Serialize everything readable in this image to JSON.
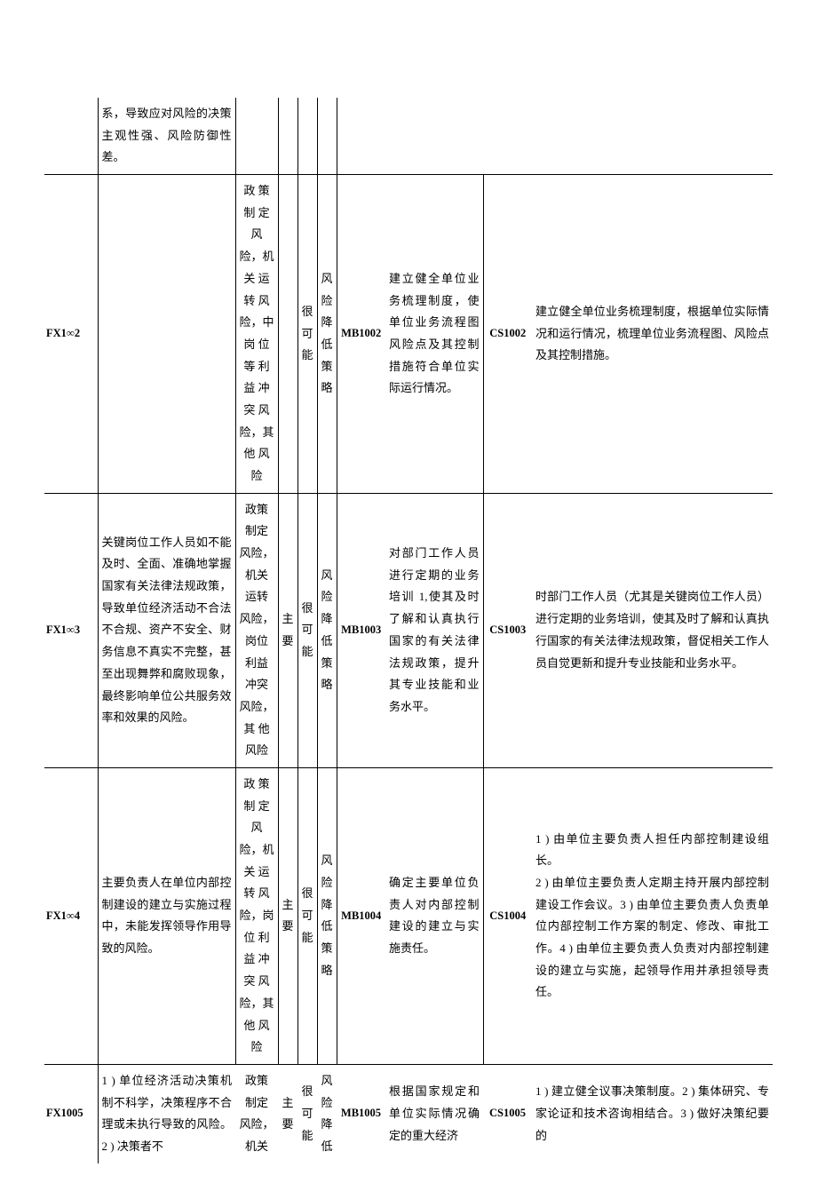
{
  "prevRow": {
    "col2_cont": "系，导致应对风险的决策主观性强、风险防御性差。"
  },
  "rows": [
    {
      "code": "FX1∞2",
      "desc": "",
      "risk": "政 策 制 定 风 险，机 关 运 转 风 险，中 岗 位 等 利 益 冲 突 风 险，其 他 风 险",
      "importance": "",
      "prob": "很 可 能",
      "strategy": "风 险 降 低 策 略",
      "mb": "MB1002",
      "target": "建立健全单位业务梳理制度，使单位业务流程图风险点及其控制措施符合单位实际运行情况。",
      "cs": "CS1002",
      "measure": "建立健全单位业务梳理制度，根据单位实际情况和运行情况，梳理单位业务流程图、风险点及其控制措施。"
    },
    {
      "code": "FX1∞3",
      "desc": "关键岗位工作人员如不能及时、全面、准确地掌握国家有关法律法规政策，导致单位经济活动不合法不合规、资产不安全、财务信息不真实不完整，甚至出现舞弊和腐败现象，最终影响单位公共服务效率和效果的风险。",
      "risk": "政策 制定 风险，机关 运转 风险，岗位 利益 冲突 风险，其 他 风险",
      "importance": "主 要",
      "prob": "很 可 能",
      "strategy": "风 险 降 低 策 略",
      "mb": "MB1003",
      "target": "对部门工作人员进行定期的业务培训 1,使其及时了解和认真执行国家的有关法律法规政策，提升其专业技能和业务水平。",
      "cs": "CS1003",
      "measure": "时部门工作人员（尤其是关键岗位工作人员）进行定期的业务培训，使其及时了解和认真执行国家的有关法律法规政策，督促相关工作人员自觉更新和提升专业技能和业务水平。"
    },
    {
      "code": "FX1∞4",
      "desc": "主要负责人在单位内部控制建设的建立与实施过程中，未能发挥领导作用导致的风险。",
      "risk": "政 策 制 定 风 险，机 关 运 转 风 险，岗 位 利 益 冲 突 风 险，其 他 风 险",
      "importance": "主 要",
      "prob": "很 可 能",
      "strategy": "风 险 降 低 策 略",
      "mb": "MB1004",
      "target": "确定主要单位负责人对内部控制建设的建立与实施责任。",
      "cs": "CS1004",
      "measure": "1 ) 由单位主要负责人担任内部控制建设组长。\n2 ) 由单位主要负责人定期主持开展内部控制建设工作会议。3 ) 由单位主要负责人负责单位内部控制工作方案的制定、修改、审批工作。4 ) 由单位主要负责人负责对内部控制建设的建立与实施，起领导作用并承担领导责任。"
    },
    {
      "code": "FX1005",
      "desc": "1 ) 单位经济活动决策机制不科学，决策程序不合理或未执行导致的风险。2 ) 决策者不",
      "risk": "政策 制定 风险，机关",
      "importance": "主 要",
      "prob": "很 可 能",
      "strategy": "风 险 降 低",
      "mb": "MB1005",
      "target": "根据国家规定和单位实际情况确定的重大经济",
      "cs": "CS1005",
      "measure": "1 ) 建立健全议事决策制度。2 ) 集体研究、专家论证和技术咨询相结合。3 ) 做好决策纪要的"
    }
  ]
}
